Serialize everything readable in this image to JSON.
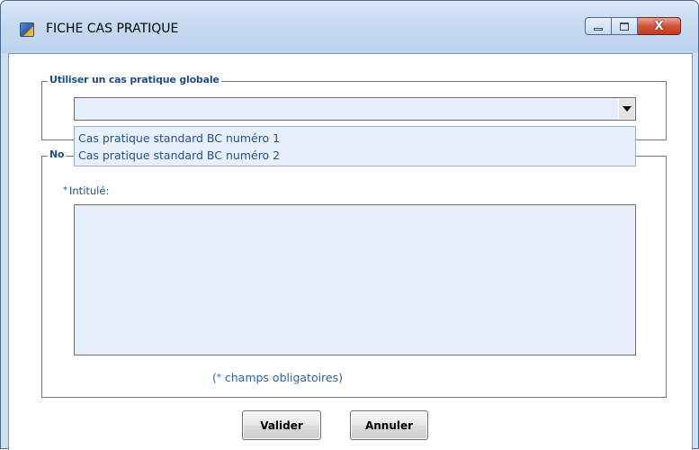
{
  "window": {
    "title": "FICHE CAS PRATIQUE",
    "icon": "app-icon",
    "controls": {
      "minimize": "minimize-icon",
      "maximize": "maximize-icon",
      "close": "close-icon",
      "close_glyph": "X"
    }
  },
  "global_case": {
    "legend": "Utiliser un cas pratique globale",
    "select_value": "",
    "options": [
      "Cas pratique standard BC numéro 1",
      "Cas pratique standard BC numéro 2"
    ]
  },
  "new_case": {
    "legend_visible": "No",
    "field_star": "*",
    "field_label": "Intitulé:",
    "field_value": ""
  },
  "required_note": {
    "prefix": "(",
    "star": "*",
    "text": " champs obligatoires)"
  },
  "buttons": {
    "validate": "Valider",
    "cancel": "Annuler"
  },
  "colors": {
    "label_blue": "#1f4d82",
    "field_bg": "#e5eefa",
    "dropdown_text": "#24518a"
  }
}
